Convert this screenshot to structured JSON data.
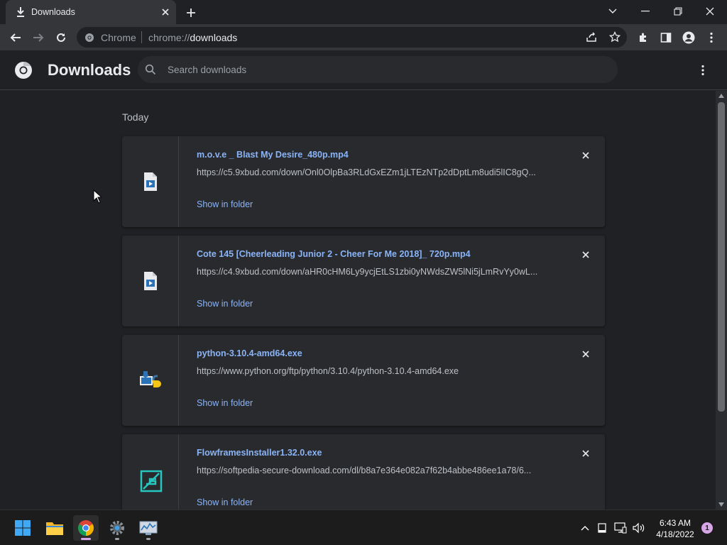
{
  "browser": {
    "tab": {
      "title": "Downloads",
      "icon": "download-icon"
    },
    "omnibox": {
      "site_label": "Chrome",
      "url_scheme": "chrome://",
      "url_host": "downloads"
    }
  },
  "page": {
    "title": "Downloads",
    "search_placeholder": "Search downloads",
    "section_label": "Today"
  },
  "downloads": [
    {
      "name": "m.o.v.e _ Blast My Desire_480p.mp4",
      "url": "https://c5.9xbud.com/down/Onl0OlpBa3RLdGxEZm1jLTEzNTp2dDptLm8udi5lIC8gQ...",
      "action": "Show in folder",
      "icon": "video-file-icon"
    },
    {
      "name": "Cote 145 [Cheerleading Junior 2 - Cheer For Me 2018]_ 720p.mp4",
      "url": "https://c4.9xbud.com/down/aHR0cHM6Ly9ycjEtLS1zbi0yNWdsZW5lNi5jLmRvYy0wL...",
      "action": "Show in folder",
      "icon": "video-file-icon"
    },
    {
      "name": "python-3.10.4-amd64.exe",
      "url": "https://www.python.org/ftp/python/3.10.4/python-3.10.4-amd64.exe",
      "action": "Show in folder",
      "icon": "python-installer-icon"
    },
    {
      "name": "FlowframesInstaller1.32.0.exe",
      "url": "https://softpedia-secure-download.com/dl/b8a7e364e082a7f62b4abbe486ee1a78/6...",
      "action": "Show in folder",
      "icon": "flowframes-icon"
    }
  ],
  "taskbar": {
    "apps": [
      "windows-start-icon",
      "file-explorer-icon",
      "chrome-icon",
      "settings-icon",
      "resource-monitor-icon"
    ],
    "clock_time": "6:43 AM",
    "clock_date": "4/18/2022",
    "notification_count": "1"
  },
  "colors": {
    "accent": "#8ab4f8",
    "background": "#202124",
    "card": "#292a2d",
    "toolbar": "#35363a"
  }
}
